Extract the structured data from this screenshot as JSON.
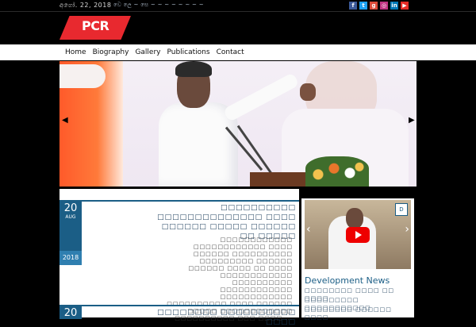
{
  "topbar": {
    "date": "අගෝ. 22, 2018",
    "ticker": "වෙ  ලෙ  ~ සෙ  ~  ~ ~ ~ ~ ~ ~ ~",
    "socials": [
      {
        "name": "facebook",
        "glyph": "f",
        "color": "#3b5998"
      },
      {
        "name": "twitter",
        "glyph": "t",
        "color": "#1da1f2"
      },
      {
        "name": "google-plus",
        "glyph": "g",
        "color": "#dd4b39"
      },
      {
        "name": "instagram",
        "glyph": "◎",
        "color": "#c13584"
      },
      {
        "name": "linkedin",
        "glyph": "in",
        "color": "#0077b5"
      },
      {
        "name": "youtube",
        "glyph": "▶",
        "color": "#e52d27"
      }
    ]
  },
  "brand": {
    "logo_text": "PCR",
    "accent": "#e8292f"
  },
  "nav": {
    "items": [
      "Home",
      "Biography",
      "Gallery",
      "Publications",
      "Contact"
    ]
  },
  "slider": {
    "prev": "◀",
    "next": "▶"
  },
  "posts": [
    {
      "day": "20",
      "month": "AUG",
      "year": "2018",
      "title": "□□□□□□□□□□ □□□□□□□□□□□□□□ □□□□ □□□□□□ □□□□□ □□□□□□ □□ □□□□□",
      "excerpt": "□□□□□□□□□□□□ □□□□□□□□□□□□ □□□□ □□□□□□ □□□□□□□□□□ □□□□□□□□□ □□□□□□ □□□□□□ □□□□ □□ □□□□ □□□□□□□□□□□□ □□□□□□□□□□ □□□□□□□□□□□□ □□□□□□□□□□□□ □□□□□□□□□□ □□□□ □□□□□□ □□□□□ □□□□□□□□□□□□ □□□□□□□□□□ □□□ □□□□ ..."
    },
    {
      "day": "20",
      "title": "□□□□□□□□ □□□□□□□□□□ □□□□"
    }
  ],
  "widget": {
    "video_logo": "D",
    "title": "Development News",
    "lines": [
      "□□□□□□□□ □□□□ □□ □□□□",
      "□□□□□□□□□ □□□□□□□□□□□",
      "□□□□□□□□ □□□□□□ □□□□"
    ]
  }
}
